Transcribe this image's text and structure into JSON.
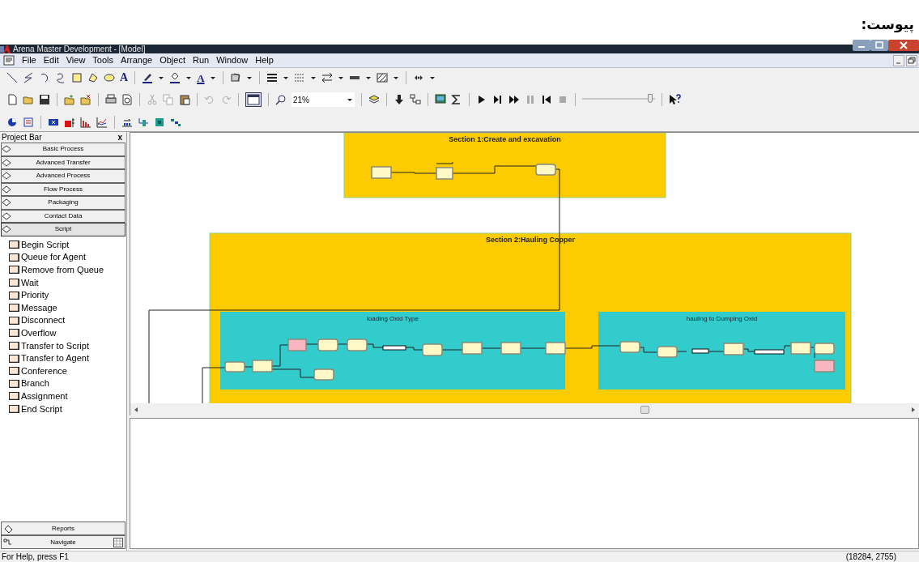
{
  "page_caption": "پیوست:",
  "window": {
    "title": "Arena Master Development - [Model]"
  },
  "menu": [
    "File",
    "Edit",
    "View",
    "Tools",
    "Arrange",
    "Object",
    "Run",
    "Window",
    "Help"
  ],
  "draw_toolbar": {
    "text_tool": "A",
    "text_color_tool": "A"
  },
  "standard_toolbar": {
    "zoom": "21%",
    "speed_slider": {
      "level": 0.97
    }
  },
  "project_bar": {
    "title": "Project Bar",
    "close": "x",
    "panels": [
      {
        "label": "Basic Process",
        "expanded": false
      },
      {
        "label": "Advanced Transfer",
        "expanded": false
      },
      {
        "label": "Advanced Process",
        "expanded": false
      },
      {
        "label": "Flow Process",
        "expanded": false
      },
      {
        "label": "Packaging",
        "expanded": false
      },
      {
        "label": "Contact Data",
        "expanded": false
      },
      {
        "label": "Script",
        "expanded": true
      }
    ],
    "items": [
      "Begin Script",
      "Queue for Agent",
      "Remove from Queue",
      "Wait",
      "Priority",
      "Message",
      "Disconnect",
      "Overflow",
      "Transfer to Script",
      "Transfer to Agent",
      "Conference",
      "Branch",
      "Assignment",
      "End Script"
    ],
    "bottom_panels": [
      "Reports",
      "Navigate"
    ]
  },
  "canvas": {
    "sections": [
      {
        "title": "Section 1:Create and excavation"
      },
      {
        "title": "Section 2:Hauling Copper",
        "subsections": [
          {
            "title": "loading Oxid Type"
          },
          {
            "title": "hauling to Dumping Oxid"
          }
        ]
      }
    ]
  },
  "status_bar": {
    "help": "For Help, press F1",
    "coordinates": "(18284, 2755)"
  }
}
